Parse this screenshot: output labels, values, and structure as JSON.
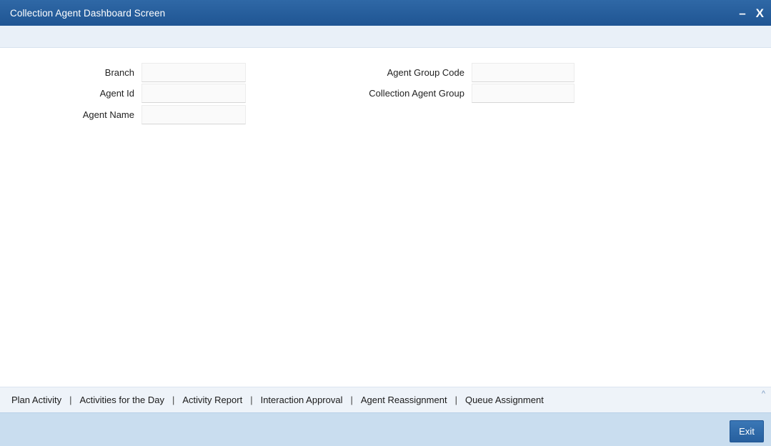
{
  "window": {
    "title": "Collection Agent Dashboard Screen",
    "minimize_glyph": "–",
    "close_glyph": "X"
  },
  "form": {
    "left": [
      {
        "label": "Branch",
        "value": ""
      },
      {
        "label": "Agent Id",
        "value": ""
      },
      {
        "label": "Agent Name",
        "value": ""
      }
    ],
    "right": [
      {
        "label": "Agent Group Code",
        "value": ""
      },
      {
        "label": "Collection Agent Group",
        "value": ""
      }
    ]
  },
  "links": {
    "plan_activity": "Plan Activity",
    "activities_for_the_day": "Activities for the Day",
    "activity_report": "Activity Report",
    "interaction_approval": "Interaction Approval",
    "agent_reassignment": "Agent Reassignment",
    "queue_assignment": "Queue Assignment",
    "separator": "|",
    "collapse_glyph": "^"
  },
  "footer": {
    "exit_label": "Exit"
  },
  "colors": {
    "title_bar": "#1f5593",
    "toolbar_strip": "#e9f0f8",
    "footer": "#c9ddef",
    "exit_button": "#275f9e"
  }
}
